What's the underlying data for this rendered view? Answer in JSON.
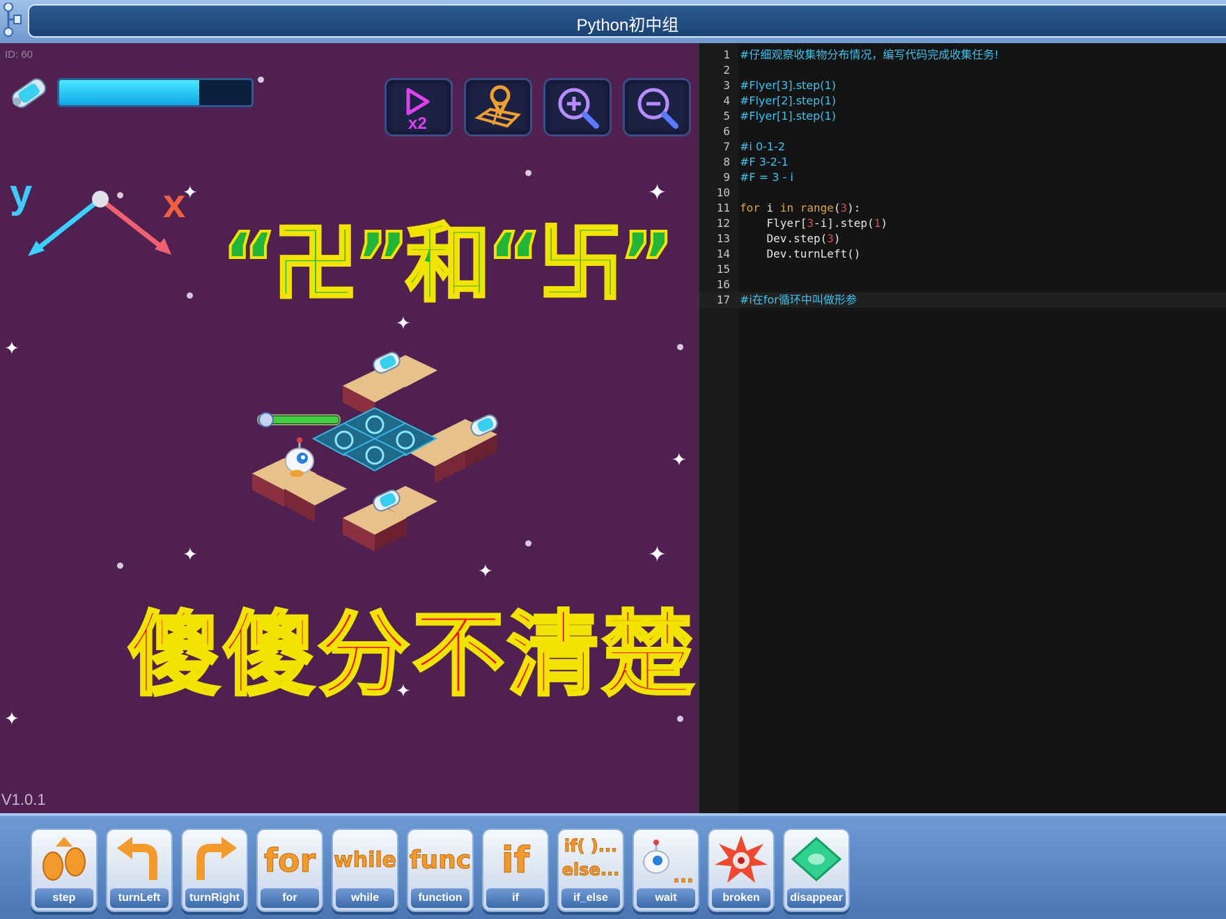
{
  "app": {
    "title": "Python初中组"
  },
  "game": {
    "level_id": "ID: 60",
    "version": "V1.0.1",
    "energy_level": 0.73,
    "axis_labels": {
      "y": "y",
      "x": "x"
    },
    "overlay_top": "“卍”和“卐”",
    "overlay_bottom": "傻傻分不清楚",
    "tools": [
      {
        "name": "speed-x2",
        "icon": "play-x2-icon"
      },
      {
        "name": "map",
        "icon": "map-pin-icon"
      },
      {
        "name": "zoom-in",
        "icon": "zoom-in-icon"
      },
      {
        "name": "zoom-out",
        "icon": "zoom-out-icon"
      }
    ]
  },
  "editor": {
    "lines": [
      {
        "n": "1",
        "text": "#仔细观察收集物分布情况，编写代码完成收集任务!"
      },
      {
        "n": "2",
        "text": ""
      },
      {
        "n": "3",
        "text": "#Flyer[3].step(1)"
      },
      {
        "n": "4",
        "text": "#Flyer[2].step(1)"
      },
      {
        "n": "5",
        "text": "#Flyer[1].step(1)"
      },
      {
        "n": "6",
        "text": ""
      },
      {
        "n": "7",
        "text": "#i 0-1-2"
      },
      {
        "n": "8",
        "text": "#F 3-2-1"
      },
      {
        "n": "9",
        "text": "#F = 3 - i"
      },
      {
        "n": "10",
        "text": ""
      },
      {
        "n": "11",
        "text": "for i in range(3):"
      },
      {
        "n": "12",
        "text": "    Flyer[3-i].step(1)"
      },
      {
        "n": "13",
        "text": "    Dev.step(3)"
      },
      {
        "n": "14",
        "text": "    Dev.turnLeft()"
      },
      {
        "n": "15",
        "text": ""
      },
      {
        "n": "16",
        "text": ""
      },
      {
        "n": "17",
        "text": "#i在for循环中叫做形参"
      }
    ]
  },
  "blocks": [
    {
      "label": "step",
      "icon": "step-feet-icon"
    },
    {
      "label": "turnLeft",
      "icon": "turn-left-arrow-icon"
    },
    {
      "label": "turnRight",
      "icon": "turn-right-arrow-icon"
    },
    {
      "label": "for",
      "icon": "for-word-icon",
      "word": "for"
    },
    {
      "label": "while",
      "icon": "while-word-icon",
      "word": "while"
    },
    {
      "label": "function",
      "icon": "func-word-icon",
      "word": "func"
    },
    {
      "label": "if",
      "icon": "if-word-icon",
      "word": "if"
    },
    {
      "label": "if_else",
      "icon": "if-else-word-icon",
      "word": "if( )...",
      "word2": "else..."
    },
    {
      "label": "wait",
      "icon": "robot-wait-icon",
      "word": "..."
    },
    {
      "label": "broken",
      "icon": "broken-burst-icon"
    },
    {
      "label": "disappear",
      "icon": "disappear-tile-icon"
    }
  ],
  "colors": {
    "game_bg": "#4f2050",
    "editor_bg": "#141414",
    "comment": "#3ec3f0",
    "keyword": "#d9a44a",
    "number": "#d05050",
    "energy": "#27c7f5"
  }
}
